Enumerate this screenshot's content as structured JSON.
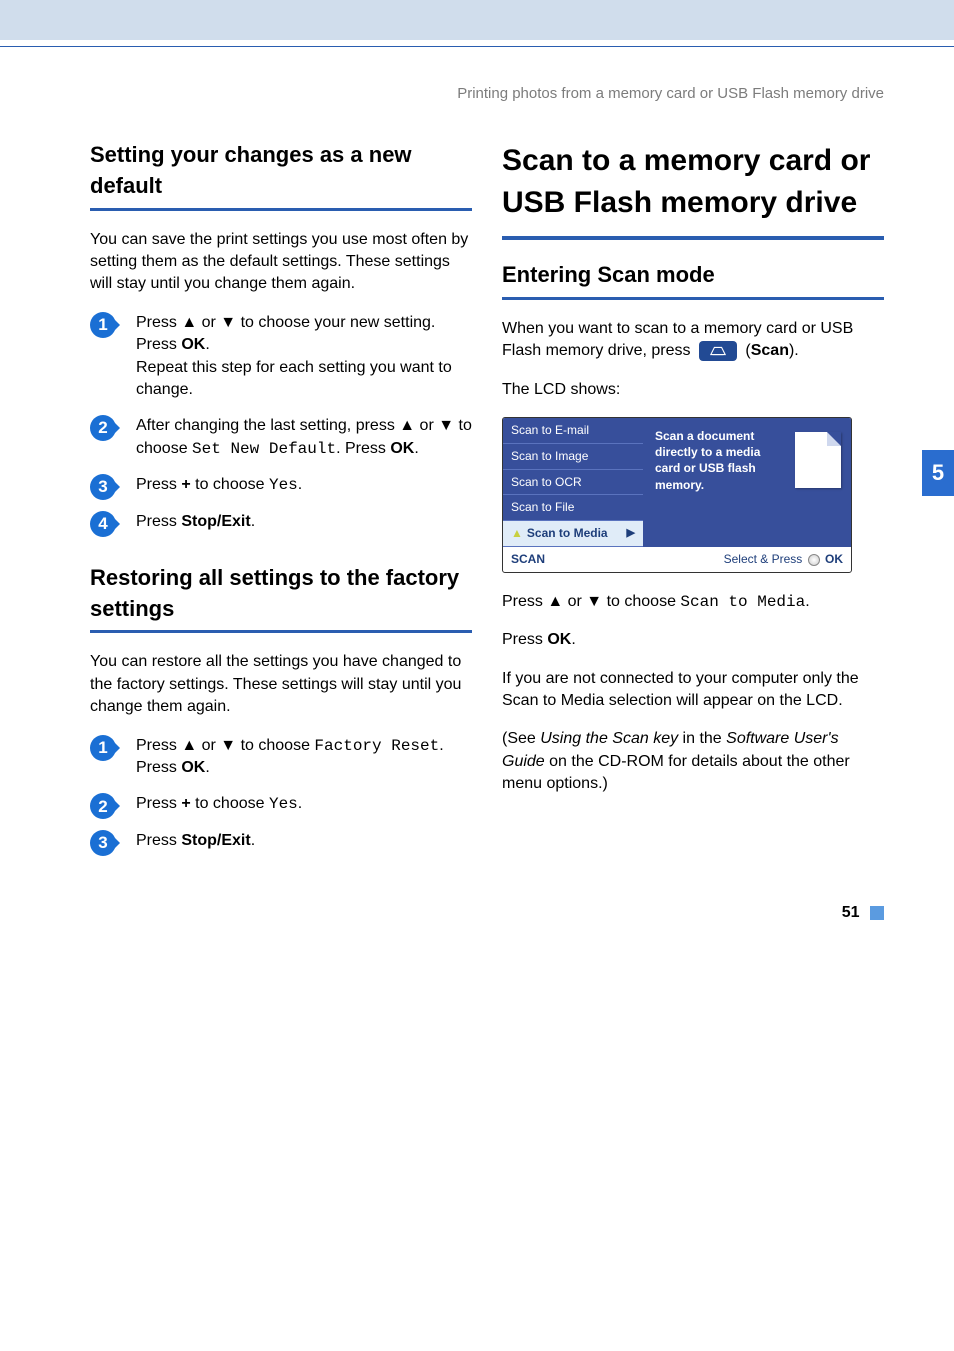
{
  "page": {
    "breadcrumb": "Printing photos from a memory card or USB Flash memory drive",
    "chapter_tab": "5",
    "page_number": "51"
  },
  "left": {
    "section1_title": "Setting your changes as a new default",
    "section1_intro": "You can save the print settings you use most often by setting them as the default settings. These settings will stay until you change them again.",
    "s1_step1_a": "Press ▲ or ▼ to choose your new setting. Press ",
    "s1_step1_ok": "OK",
    "s1_step1_b": ".",
    "s1_step1_c": "Repeat this step for each setting you want to change.",
    "s1_step2_a": "After changing the last setting, press ▲ or ▼ to choose ",
    "s1_step2_mono": "Set New Default",
    "s1_step2_b": ". Press ",
    "s1_step2_ok": "OK",
    "s1_step2_c": ".",
    "s1_step3_a": "Press ",
    "s1_step3_plus": "+",
    "s1_step3_b": " to choose ",
    "s1_step3_mono": "Yes",
    "s1_step3_c": ".",
    "s1_step4_a": "Press ",
    "s1_step4_b": "Stop/Exit",
    "s1_step4_c": ".",
    "section2_title": "Restoring all settings to the factory settings",
    "section2_intro": "You can restore all the settings you have changed to the factory settings. These settings will stay until you change them again.",
    "s2_step1_a": "Press ▲ or ▼ to choose ",
    "s2_step1_mono": "Factory Reset",
    "s2_step1_b": ". Press ",
    "s2_step1_ok": "OK",
    "s2_step1_c": ".",
    "s2_step2_a": "Press ",
    "s2_step2_plus": "+",
    "s2_step2_b": " to choose ",
    "s2_step2_mono": "Yes",
    "s2_step2_c": ".",
    "s2_step3_a": "Press ",
    "s2_step3_b": "Stop/Exit",
    "s2_step3_c": "."
  },
  "right": {
    "main_title": "Scan to a memory card or USB Flash memory drive",
    "section_title": "Entering Scan mode",
    "intro_a": "When you want to scan to a memory card or USB Flash memory drive, press ",
    "intro_scan": "Scan",
    "intro_shows": "The LCD shows:",
    "lcd": {
      "items": [
        "Scan to E-mail",
        "Scan to Image",
        "Scan to OCR",
        "Scan to File",
        "Scan to Media"
      ],
      "help": "Scan a document directly to a media card or USB flash memory.",
      "bottom_left": "SCAN",
      "bottom_right_a": "Select & Press",
      "bottom_right_b": "OK"
    },
    "after1_a": "Press ▲ or ▼ to choose ",
    "after1_mono": "Scan to Media",
    "after1_b": ".",
    "after2_a": "Press ",
    "after2_ok": "OK",
    "after2_b": ".",
    "after3": "If you are not connected to your computer only the Scan to Media selection will appear on the LCD.",
    "after4_a": "(See ",
    "after4_it1": "Using the Scan key",
    "after4_b": " in the ",
    "after4_it2": "Software User's Guide",
    "after4_c": " on the CD-ROM for details about the other menu options.)"
  }
}
